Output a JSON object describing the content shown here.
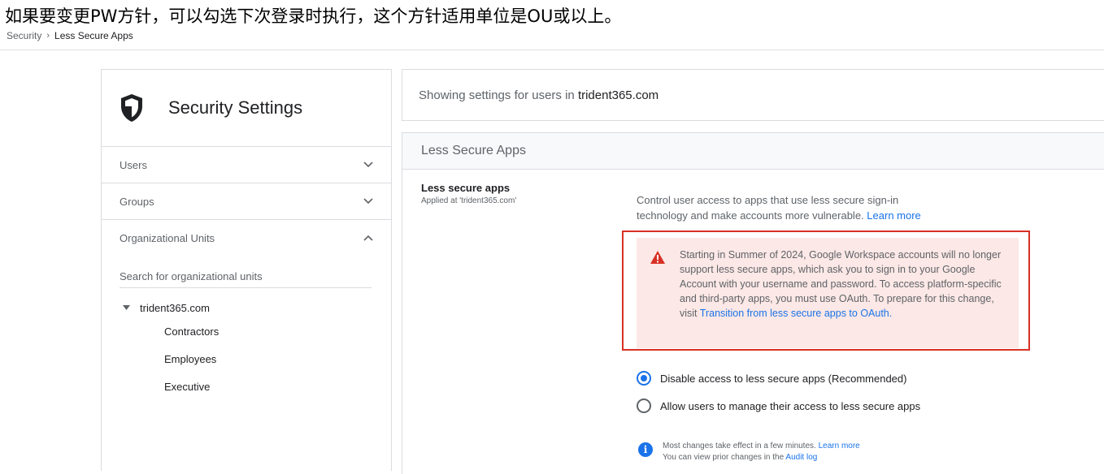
{
  "annotation_title": "如果要变更PW方针，可以勾选下次登录时执行，这个方针适用单位是OU或以上。",
  "breadcrumb": {
    "parent": "Security",
    "separator": "›",
    "current": "Less Secure Apps"
  },
  "sidebar": {
    "title": "Security Settings",
    "icon": "shield-icon",
    "sections": [
      {
        "label": "Users",
        "expanded": false
      },
      {
        "label": "Groups",
        "expanded": false
      },
      {
        "label": "Organizational Units",
        "expanded": true
      }
    ],
    "ou_search_placeholder": "Search for organizational units",
    "ou_tree": {
      "root": "trident365.com",
      "children": [
        "Contractors",
        "Employees",
        "Executive"
      ]
    }
  },
  "settings_scope": {
    "prefix": "Showing settings for users in ",
    "domain": "trident365.com"
  },
  "panel": {
    "title": "Less Secure Apps",
    "setting_name": "Less secure apps",
    "applied_at": "Applied at 'trident365.com'",
    "description": "Control user access to apps that use less secure sign-in technology and make accounts more vulnerable.",
    "learn_more": "Learn more",
    "warning": {
      "icon": "warning-icon",
      "text": "Starting in Summer of 2024, Google Workspace accounts will no longer support less secure apps, which ask you to sign in to your Google Account with your username and password. To access platform-specific and third-party apps, you must use OAuth. To prepare for this change, visit",
      "link": "Transition from less secure apps to OAuth."
    },
    "options": [
      {
        "label": "Disable access to less secure apps (Recommended)",
        "selected": true
      },
      {
        "label": "Allow users to manage their access to less secure apps",
        "selected": false
      }
    ],
    "info": {
      "line1": "Most changes take effect in a few minutes.",
      "line1_link": "Learn more",
      "line2": "You can view prior changes in the",
      "line2_link": "Audit log"
    }
  },
  "colors": {
    "accent": "#1a73e8",
    "warning_bg": "#fce8e6",
    "warning_red": "#d93025"
  }
}
